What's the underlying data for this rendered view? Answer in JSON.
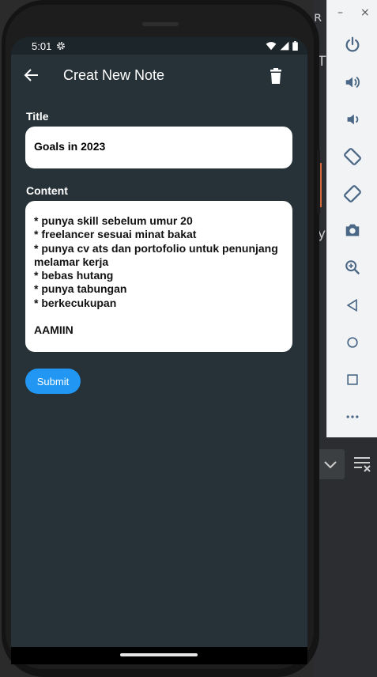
{
  "status_bar": {
    "time": "5:01"
  },
  "app_bar": {
    "title": "Creat New Note"
  },
  "form": {
    "title_label": "Title",
    "title_value": "Goals in 2023",
    "content_label": "Content",
    "content_value": "* punya skill sebelum umur 20\n* freelancer sesuai minat bakat\n* punya cv ats dan portofolio untuk penunjang melamar kerja\n* bebas hutang\n* punya tabungan\n* berkecukupan\n\nAAMIIN",
    "submit_label": "Submit"
  },
  "emulator_window": {
    "minimize": "–",
    "close": "×"
  },
  "emulator_tools": [
    "power-icon",
    "volume-up-icon",
    "volume-down-icon",
    "rotate-left-icon",
    "rotate-right-icon",
    "camera-icon",
    "zoom-icon",
    "back-icon",
    "home-icon",
    "overview-icon",
    "more-icon"
  ],
  "ide_fragments": {
    "top_glyph": "ʀ",
    "t_glyph": "T",
    "y_glyph": "y"
  },
  "colors": {
    "screen_bg": "#263238",
    "accent": "#2196f3",
    "toolbar_icon": "#4a6785"
  }
}
